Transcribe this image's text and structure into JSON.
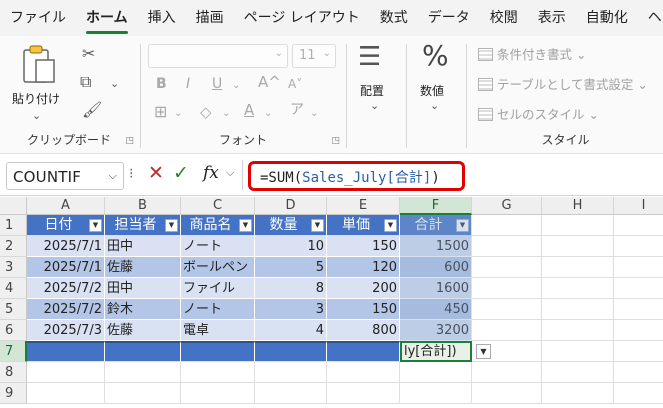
{
  "menu": {
    "tabs": [
      "ファイル",
      "ホーム",
      "挿入",
      "描画",
      "ページ レイアウト",
      "数式",
      "データ",
      "校閲",
      "表示",
      "自動化",
      "ヘル"
    ],
    "active": "ホーム"
  },
  "ribbon": {
    "clipboard": {
      "paste_label": "貼り付け",
      "group_label": "クリップボード"
    },
    "font": {
      "font_size": "11",
      "group_label": "フォント"
    },
    "alignment": {
      "label": "配置"
    },
    "number": {
      "label": "数値"
    },
    "styles": {
      "items": [
        "条件付き書式 ⌄",
        "テーブルとして書式設定 ⌄",
        "セルのスタイル ⌄"
      ],
      "group_label": "スタイル"
    }
  },
  "formula_bar": {
    "name_box": "COUNTIF",
    "formula_prefix": "=SUM(",
    "formula_ref": "Sales_July[合計]",
    "formula_suffix": ")"
  },
  "sheet": {
    "columns": [
      "A",
      "B",
      "C",
      "D",
      "E",
      "F",
      "G",
      "H",
      "I"
    ],
    "rows": [
      "1",
      "2",
      "3",
      "4",
      "5",
      "6",
      "7",
      "8",
      "9"
    ],
    "headers": [
      "日付",
      "担当者",
      "商品名",
      "数量",
      "単価",
      "合計"
    ],
    "data": [
      [
        "2025/7/1",
        "田中",
        "ノート",
        "10",
        "150",
        "1500"
      ],
      [
        "2025/7/1",
        "佐藤",
        "ボールペン",
        "5",
        "120",
        "600"
      ],
      [
        "2025/7/2",
        "田中",
        "ファイル",
        "8",
        "200",
        "1600"
      ],
      [
        "2025/7/2",
        "鈴木",
        "ノート",
        "3",
        "150",
        "450"
      ],
      [
        "2025/7/3",
        "佐藤",
        "電卓",
        "4",
        "800",
        "3200"
      ]
    ],
    "active_cell_text": "ly[合計])"
  },
  "colors": {
    "table_header": "#4472c4",
    "band_light": "#d9e1f2",
    "band_dark": "#b4c6e7",
    "accent_green": "#1a7f37",
    "highlight_red": "#e00000"
  }
}
